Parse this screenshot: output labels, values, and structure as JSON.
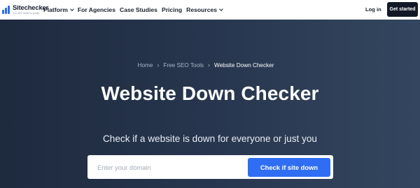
{
  "nav": {
    "logo_name": "Sitechecker",
    "logo_tagline": "Your SEO toolkit for growth",
    "menu": [
      {
        "label": "Platform",
        "dropdown": true
      },
      {
        "label": "For Agencies",
        "dropdown": false
      },
      {
        "label": "Case Studies",
        "dropdown": false
      },
      {
        "label": "Pricing",
        "dropdown": false
      },
      {
        "label": "Resources",
        "dropdown": true
      }
    ],
    "login_label": "Log in",
    "get_started_label": "Get started"
  },
  "breadcrumb": {
    "items": [
      "Home",
      "Free SEO Tools",
      "Website Down Checker"
    ]
  },
  "hero": {
    "title": "Website Down Checker",
    "subtitle": "Check if a website is down for everyone or just you"
  },
  "search": {
    "placeholder": "Enter your domain",
    "value": "",
    "button_label": "Check if site down"
  },
  "colors": {
    "accent": "#2f6ef2",
    "hero_bg": "#27364e",
    "dark_button": "#121826"
  }
}
